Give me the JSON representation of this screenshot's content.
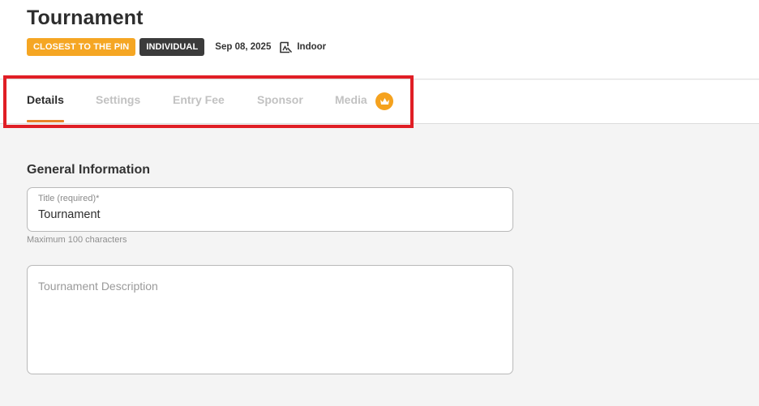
{
  "header": {
    "title": "Tournament",
    "badges": [
      {
        "label": "CLOSEST TO THE PIN",
        "color": "#f5a623"
      },
      {
        "label": "INDIVIDUAL",
        "color": "#3b3b3b"
      }
    ],
    "date": "Sep 08, 2025",
    "venue_icon": "flag-map-icon",
    "venue": "Indoor"
  },
  "tabs": [
    {
      "label": "Details",
      "active": true
    },
    {
      "label": "Settings",
      "active": false
    },
    {
      "label": "Entry Fee",
      "active": false
    },
    {
      "label": "Sponsor",
      "active": false
    },
    {
      "label": "Media",
      "active": false,
      "badge_icon": "crown-icon"
    }
  ],
  "accent_color": "#e8832a",
  "highlight_color": "#e01e25",
  "general": {
    "section_title": "General Information",
    "title_field": {
      "label": "Title (required)*",
      "value": "Tournament",
      "helper": "Maximum 100 characters"
    },
    "description_field": {
      "placeholder": "Tournament Description",
      "value": ""
    }
  }
}
